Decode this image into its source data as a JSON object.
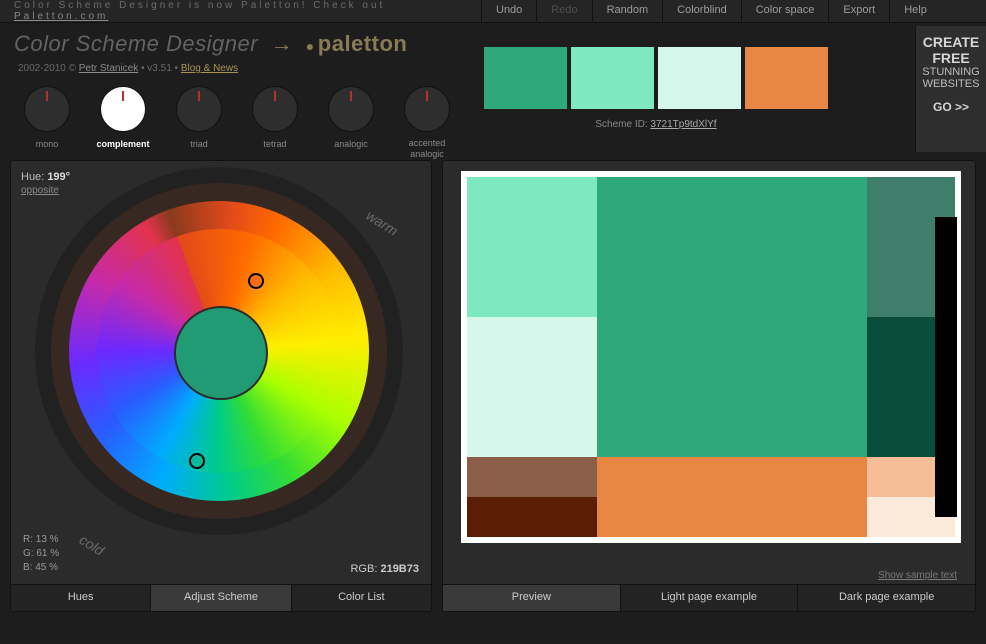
{
  "announce": {
    "text": "Color Scheme Designer is now Paletton! Check out ",
    "link": "Paletton.com"
  },
  "menu": {
    "undo": "Undo",
    "redo": "Redo",
    "random": "Random",
    "colorblind": "Colorblind",
    "colorspace": "Color space",
    "export": "Export",
    "help": "Help"
  },
  "brand": {
    "title": "Color Scheme Designer",
    "arrow": "→",
    "paletton": "paletton"
  },
  "subtitle": {
    "years": "2002-2010 ©",
    "author": "Petr Stanicek",
    "ver": "• v3.51 •",
    "blog": "Blog & News"
  },
  "modes": {
    "mono": "mono",
    "complement": "complement",
    "triad": "triad",
    "tetrad": "tetrad",
    "analogic": "analogic",
    "accented": "accented analogic"
  },
  "swatches": {
    "c1": "#2fa87c",
    "c2": "#7ee9c0",
    "c3": "#d6f7eb",
    "c4": "#e88644"
  },
  "scheme": {
    "label": "Scheme ID:",
    "id": "3721Tp9tdXlYf"
  },
  "promo": {
    "l1": "CREATE",
    "l2": "FREE",
    "l3": "STUNNING",
    "l4": "WEBSITES",
    "go": "GO >>"
  },
  "hue": {
    "label": "Hue:",
    "deg": "199°",
    "opp": "opposite"
  },
  "ring": {
    "warm": "warm",
    "cold": "cold"
  },
  "readout": {
    "r": "R: 13 %",
    "g": "G: 61 %",
    "b": "B: 45 %",
    "rgb_label": "RGB:",
    "rgb": "219B73"
  },
  "left_tabs": {
    "hues": "Hues",
    "adjust": "Adjust Scheme",
    "list": "Color List"
  },
  "right_tabs": {
    "preview": "Preview",
    "light": "Light page example",
    "dark": "Dark page example"
  },
  "sample": "Show sample text",
  "preview_colors": {
    "teal_main": "#2fa87c",
    "mint": "#7ee9c0",
    "pale": "#d6f7eb",
    "teal_mid": "#3f7e6a",
    "teal_dark": "#0b4d3b",
    "orange": "#e88644",
    "peach": "#f6be96",
    "cream": "#fbe9da",
    "brown": "#8a5e49",
    "rust": "#5a1e05"
  }
}
